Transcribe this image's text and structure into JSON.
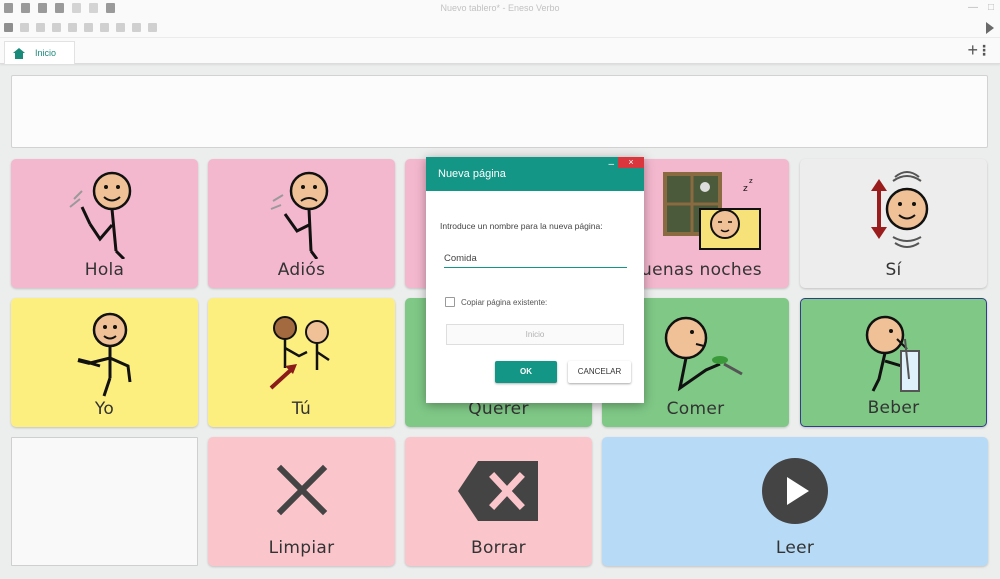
{
  "window": {
    "title": "Nuevo tablero* - Eneso Verbo",
    "controls": [
      "minimize-icon",
      "maximize-icon"
    ]
  },
  "toolbar": {
    "icons": [
      "edit-icon",
      "copy-icon",
      "cut-icon",
      "paste-icon",
      "delete-icon",
      "align-icon",
      "columns-icon",
      "rows-icon",
      "list-icon",
      "screen-icon"
    ],
    "play_icon": "play-icon"
  },
  "tabs": [
    {
      "label": "Inicio",
      "icon": "home-icon",
      "active": true
    }
  ],
  "tabbar_actions": {
    "add_icon": "plus-icon",
    "menu_icon": "kebab-menu-icon"
  },
  "board": {
    "cells": [
      {
        "label": "Hola",
        "color": "#f4b8ce",
        "pictogram": "waving-hello"
      },
      {
        "label": "Adiós",
        "color": "#f4b8ce",
        "pictogram": "waving-goodbye"
      },
      {
        "label": "",
        "color": "#f4b8ce",
        "pictogram": "hidden-by-dialog"
      },
      {
        "label": "Buenas noches",
        "color": "#f4b8ce",
        "pictogram": "sleeping-window"
      },
      {
        "label": "Sí",
        "color": "#ededee",
        "pictogram": "nodding-yes"
      },
      {
        "label": "Yo",
        "color": "#fcef7f",
        "pictogram": "pointing-self"
      },
      {
        "label": "Tú",
        "color": "#fcef7f",
        "pictogram": "pointing-you"
      },
      {
        "label": "Querer",
        "color": "#7fc886",
        "pictogram": "want"
      },
      {
        "label": "Comer",
        "color": "#7fc886",
        "pictogram": "eating"
      },
      {
        "label": "Beber",
        "color": "#7fc886",
        "pictogram": "drinking"
      },
      {
        "label": "",
        "color": "#f9f9f9",
        "pictogram": "empty"
      },
      {
        "label": "Limpiar",
        "color": "#fac6cc",
        "pictogram": "clear-x-icon"
      },
      {
        "label": "Borrar",
        "color": "#fac6cc",
        "pictogram": "backspace-icon"
      },
      {
        "label": "Leer",
        "color": "#b7dbf6",
        "pictogram": "play-circle-icon"
      }
    ]
  },
  "dialog": {
    "title": "Nueva página",
    "prompt": "Introduce un nombre para la nueva página:",
    "name_value": "Comida",
    "copy_label": "Copiar página existente:",
    "copy_checked": false,
    "page_select_value": "Inicio",
    "ok_label": "OK",
    "cancel_label": "CANCELAR",
    "close_icon": "×",
    "minimize_icon": "–"
  },
  "colors": {
    "accent": "#149687",
    "close_red": "#d9363e"
  }
}
